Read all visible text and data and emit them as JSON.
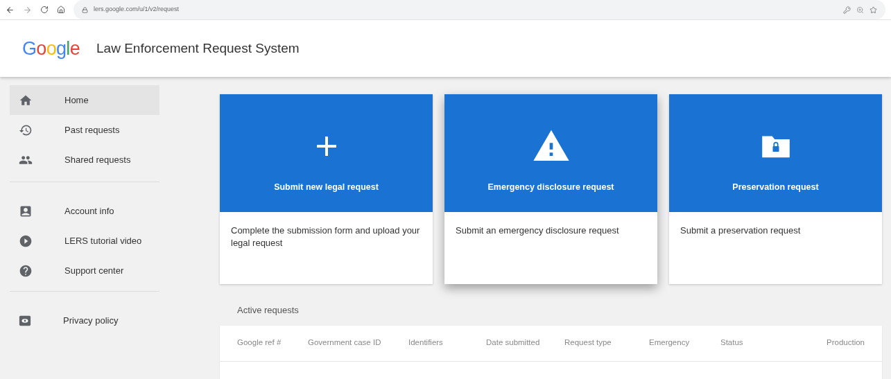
{
  "browser": {
    "url": "lers.google.com/u/1/v2/request"
  },
  "header": {
    "logo": "Google",
    "title": "Law Enforcement Request System"
  },
  "sidebar": {
    "groups": [
      [
        {
          "label": "Home",
          "selected": true
        },
        {
          "label": "Past requests",
          "selected": false
        },
        {
          "label": "Shared requests",
          "selected": false
        }
      ],
      [
        {
          "label": "Account info",
          "selected": false
        },
        {
          "label": "LERS tutorial video",
          "selected": false
        },
        {
          "label": "Support center",
          "selected": false
        }
      ],
      [
        {
          "label": "Privacy policy",
          "selected": false
        }
      ]
    ]
  },
  "cards": [
    {
      "title": "Submit new legal request",
      "description": "Complete the submission form and upload your legal request",
      "raised": false
    },
    {
      "title": "Emergency disclosure request",
      "description": "Submit an emergency disclosure request",
      "raised": true
    },
    {
      "title": "Preservation request",
      "description": "Submit a preservation request",
      "raised": false
    }
  ],
  "active_requests": {
    "title": "Active requests",
    "columns": [
      "Google ref #",
      "Government case ID",
      "Identifiers",
      "Date submitted",
      "Request type",
      "Emergency",
      "Status",
      "Production"
    ]
  }
}
